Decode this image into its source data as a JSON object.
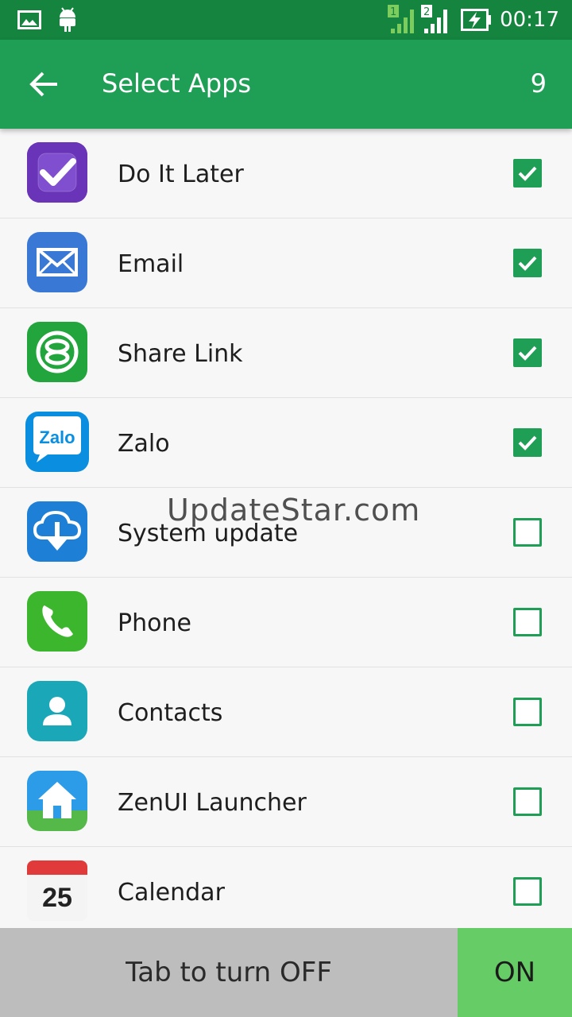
{
  "status_bar": {
    "time": "00:17",
    "sim1": "1",
    "sim2": "2"
  },
  "app_bar": {
    "title": "Select Apps",
    "count": "9"
  },
  "apps": [
    {
      "name": "Do It Later",
      "checked": true,
      "icon": "do-it-later-icon"
    },
    {
      "name": "Email",
      "checked": true,
      "icon": "email-icon"
    },
    {
      "name": "Share Link",
      "checked": true,
      "icon": "share-link-icon"
    },
    {
      "name": "Zalo",
      "checked": true,
      "icon": "zalo-icon",
      "icon_text": "Zalo"
    },
    {
      "name": "System update",
      "checked": false,
      "icon": "system-update-icon"
    },
    {
      "name": "Phone",
      "checked": false,
      "icon": "phone-icon"
    },
    {
      "name": "Contacts",
      "checked": false,
      "icon": "contacts-icon"
    },
    {
      "name": "ZenUI Launcher",
      "checked": false,
      "icon": "zenui-launcher-icon"
    },
    {
      "name": "Calendar",
      "checked": false,
      "icon": "calendar-icon",
      "icon_text": "25"
    }
  ],
  "bottom_bar": {
    "toggle_label": "Tab to turn OFF",
    "on_label": "ON"
  },
  "watermark": "UpdateStar.com",
  "colors": {
    "status_bar": "#15843f",
    "app_bar": "#1f9e56",
    "check": "#1f9e56",
    "on_button": "#66cc66",
    "off_bar": "#bdbdbd"
  }
}
